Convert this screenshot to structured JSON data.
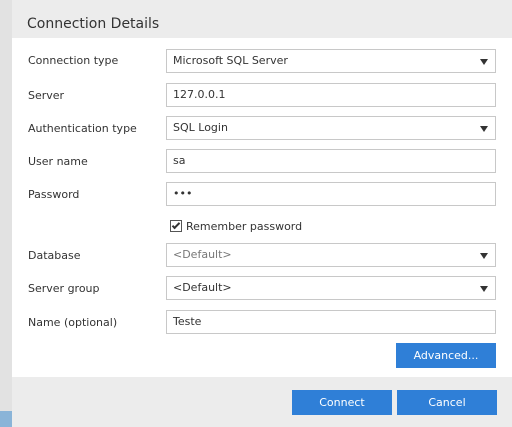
{
  "header": {
    "title": "Connection Details"
  },
  "form": {
    "connection_type": {
      "label": "Connection type",
      "value": "Microsoft SQL Server"
    },
    "server": {
      "label": "Server",
      "value": "127.0.0.1"
    },
    "auth_type": {
      "label": "Authentication type",
      "value": "SQL Login"
    },
    "user_name": {
      "label": "User name",
      "value": "sa"
    },
    "password": {
      "label": "Password",
      "value": "•••"
    },
    "remember": {
      "label": "Remember password",
      "checked": true
    },
    "database": {
      "label": "Database",
      "placeholder": "<Default>"
    },
    "server_group": {
      "label": "Server group",
      "value": "<Default>"
    },
    "name": {
      "label": "Name (optional)",
      "value": "Teste"
    },
    "advanced_label": "Advanced..."
  },
  "footer": {
    "connect_label": "Connect",
    "cancel_label": "Cancel"
  },
  "colors": {
    "accent": "#2f7fd7",
    "header_bg": "#ececec"
  }
}
